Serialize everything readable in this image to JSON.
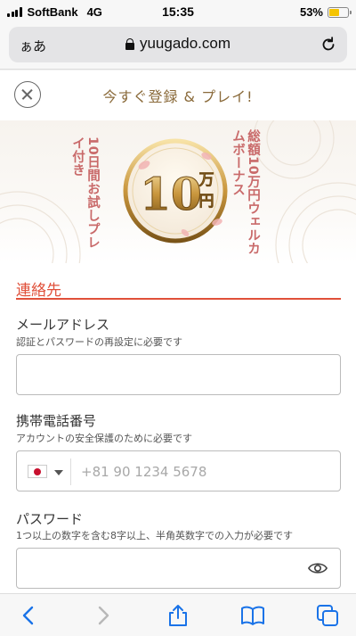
{
  "status_bar": {
    "carrier": "SoftBank",
    "network": "4G",
    "time": "15:35",
    "battery_percent_label": "53%",
    "battery_level": 0.53
  },
  "browser": {
    "text_size_label": "ぁあ",
    "url": "yuugado.com"
  },
  "modal": {
    "title": "今すぐ登録 & プレイ!"
  },
  "banner": {
    "left_text": "10日間お試しプレイ付き",
    "right_text": "総額10万円ウェルカムボーナス",
    "medal_number": "10",
    "medal_unit": "万円"
  },
  "form": {
    "section_title": "連絡先",
    "email": {
      "label": "メールアドレス",
      "hint": "認証とパスワードの再設定に必要です",
      "value": ""
    },
    "phone": {
      "label": "携帯電話番号",
      "hint": "アカウントの安全保護のために必要です",
      "placeholder": "+81 90 1234 5678"
    },
    "password": {
      "label": "パスワード",
      "hint": "1つ以上の数字を含む8字以上、半角英数字での入力が必要です",
      "value": ""
    }
  },
  "colors": {
    "accent_red": "#e0503a",
    "title_gold": "#8a6a3a",
    "browser_blue": "#1a73e8"
  }
}
